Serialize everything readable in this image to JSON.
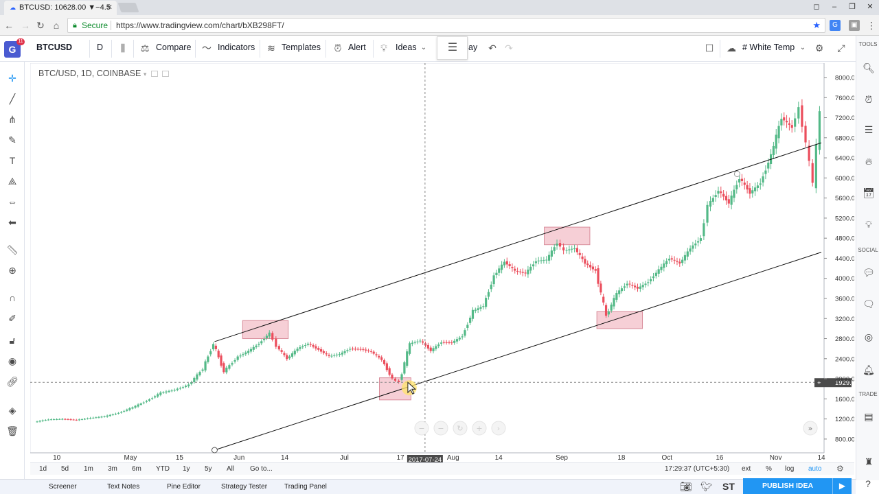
{
  "browser": {
    "tab_title": "BTCUSD: 10628.00 ▼−4.5",
    "secure_label": "Secure",
    "url": "https://www.tradingview.com/chart/bXB298FT/"
  },
  "toolbar": {
    "symbol": "BTCUSD",
    "interval": "D",
    "compare": "Compare",
    "indicators": "Indicators",
    "templates": "Templates",
    "alert": "Alert",
    "ideas": "Ideas",
    "replay_fragment": "ay",
    "theme": "# White Temp",
    "logo_letter": "G",
    "logo_badge": "11"
  },
  "legend": {
    "title": "BTC/USD, 1D, COINBASE"
  },
  "right_sidebar": {
    "tools": "TOOLS",
    "social": "SOCIAL",
    "trade": "TRADE"
  },
  "range_bar": {
    "ranges": [
      "1d",
      "5d",
      "1m",
      "3m",
      "6m",
      "YTD",
      "1y",
      "5y",
      "All"
    ],
    "goto": "Go to...",
    "clock": "17:29:37 (UTC+5:30)",
    "ext": "ext",
    "pct": "%",
    "log": "log",
    "auto": "auto"
  },
  "bottom_tabs": [
    "Screener",
    "Text Notes",
    "Pine Editor",
    "Strategy Tester",
    "Trading Panel"
  ],
  "publish_label": "PUBLISH IDEA",
  "stocktwits_label": "ST",
  "colors": {
    "up": "#53b987",
    "down": "#eb4d5c",
    "accent": "#2196f3",
    "highlight": "#f4c7cf"
  },
  "chart_data": {
    "type": "candlestick",
    "yaxis": {
      "ticks": [
        800,
        1200,
        1600,
        2000,
        2400,
        2800,
        3200,
        3600,
        4000,
        4400,
        4800,
        5200,
        5600,
        6000,
        6400,
        6800,
        7200,
        7600,
        8000
      ],
      "tick_labels": [
        "800.00",
        "1200.00",
        "1600.00",
        "2000.00",
        "2400.00",
        "2800.00",
        "3200.00",
        "3600.00",
        "4000.00",
        "4400.00",
        "4800.00",
        "5200.00",
        "5600.00",
        "6000.00",
        "6400.00",
        "6800.00",
        "7200.00",
        "7600.00",
        "8000.00"
      ],
      "ylim": [
        580,
        8150
      ]
    },
    "xaxis": {
      "labels": [
        "10",
        "May",
        "15",
        "Jun",
        "14",
        "Jul",
        "17",
        "Aug",
        "14",
        "Sep",
        "18",
        "Oct",
        "16",
        "Nov",
        "14"
      ],
      "label_dates": [
        "2017-04-10",
        "2017-05-01",
        "2017-05-15",
        "2017-06-01",
        "2017-06-14",
        "2017-07-01",
        "2017-07-17",
        "2017-08-01",
        "2017-08-14",
        "2017-09-01",
        "2017-09-18",
        "2017-10-01",
        "2017-10-16",
        "2017-11-01",
        "2017-11-14"
      ],
      "range": [
        "2017-04-04",
        "2017-11-14"
      ]
    },
    "crosshair": {
      "date_label": "2017-07-24",
      "price_label": "1929.80",
      "price": 1929.8
    },
    "closes": [
      [
        "2017-04-04",
        1140
      ],
      [
        "2017-04-08",
        1190
      ],
      [
        "2017-04-12",
        1200
      ],
      [
        "2017-04-16",
        1180
      ],
      [
        "2017-04-20",
        1220
      ],
      [
        "2017-04-24",
        1250
      ],
      [
        "2017-04-28",
        1320
      ],
      [
        "2017-05-02",
        1430
      ],
      [
        "2017-05-06",
        1560
      ],
      [
        "2017-05-10",
        1720
      ],
      [
        "2017-05-14",
        1780
      ],
      [
        "2017-05-18",
        1880
      ],
      [
        "2017-05-22",
        2200
      ],
      [
        "2017-05-25",
        2700
      ],
      [
        "2017-05-28",
        2150
      ],
      [
        "2017-06-01",
        2440
      ],
      [
        "2017-06-04",
        2550
      ],
      [
        "2017-06-07",
        2700
      ],
      [
        "2017-06-10",
        2910
      ],
      [
        "2017-06-12",
        2650
      ],
      [
        "2017-06-15",
        2400
      ],
      [
        "2017-06-18",
        2600
      ],
      [
        "2017-06-21",
        2700
      ],
      [
        "2017-06-24",
        2580
      ],
      [
        "2017-06-27",
        2450
      ],
      [
        "2017-06-30",
        2490
      ],
      [
        "2017-07-03",
        2600
      ],
      [
        "2017-07-06",
        2590
      ],
      [
        "2017-07-09",
        2540
      ],
      [
        "2017-07-12",
        2380
      ],
      [
        "2017-07-15",
        2000
      ],
      [
        "2017-07-17",
        1930
      ],
      [
        "2017-07-20",
        2700
      ],
      [
        "2017-07-23",
        2760
      ],
      [
        "2017-07-26",
        2560
      ],
      [
        "2017-07-29",
        2730
      ],
      [
        "2017-08-01",
        2720
      ],
      [
        "2017-08-04",
        2850
      ],
      [
        "2017-08-07",
        3350
      ],
      [
        "2017-08-10",
        3450
      ],
      [
        "2017-08-13",
        4050
      ],
      [
        "2017-08-16",
        4330
      ],
      [
        "2017-08-19",
        4150
      ],
      [
        "2017-08-22",
        4100
      ],
      [
        "2017-08-25",
        4350
      ],
      [
        "2017-08-28",
        4370
      ],
      [
        "2017-08-31",
        4710
      ],
      [
        "2017-09-02",
        4550
      ],
      [
        "2017-09-05",
        4600
      ],
      [
        "2017-09-08",
        4300
      ],
      [
        "2017-09-11",
        4150
      ],
      [
        "2017-09-14",
        3250
      ],
      [
        "2017-09-17",
        3700
      ],
      [
        "2017-09-20",
        3900
      ],
      [
        "2017-09-23",
        3800
      ],
      [
        "2017-09-26",
        3930
      ],
      [
        "2017-09-29",
        4170
      ],
      [
        "2017-10-02",
        4400
      ],
      [
        "2017-10-05",
        4300
      ],
      [
        "2017-10-08",
        4600
      ],
      [
        "2017-10-11",
        4800
      ],
      [
        "2017-10-13",
        5450
      ],
      [
        "2017-10-16",
        5750
      ],
      [
        "2017-10-19",
        5500
      ],
      [
        "2017-10-22",
        6000
      ],
      [
        "2017-10-25",
        5700
      ],
      [
        "2017-10-28",
        5900
      ],
      [
        "2017-10-31",
        6450
      ],
      [
        "2017-11-03",
        7200
      ],
      [
        "2017-11-06",
        7000
      ],
      [
        "2017-11-08",
        7400
      ],
      [
        "2017-11-10",
        6700
      ],
      [
        "2017-11-12",
        5900
      ],
      [
        "2017-11-14",
        7300
      ]
    ],
    "channel": {
      "upper": [
        [
          "2017-05-25",
          2740
        ],
        [
          "2017-11-14",
          6700
        ]
      ],
      "lower": [
        [
          "2017-05-25",
          580
        ],
        [
          "2017-11-14",
          4520
        ]
      ]
    },
    "highlights": [
      {
        "start": "2017-06-02",
        "end": "2017-06-15",
        "low": 2800,
        "high": 3160
      },
      {
        "start": "2017-07-11",
        "end": "2017-07-20",
        "low": 1580,
        "high": 2020
      },
      {
        "start": "2017-08-27",
        "end": "2017-09-09",
        "low": 4670,
        "high": 5020
      },
      {
        "start": "2017-09-11",
        "end": "2017-09-24",
        "low": 3000,
        "high": 3340
      }
    ]
  }
}
